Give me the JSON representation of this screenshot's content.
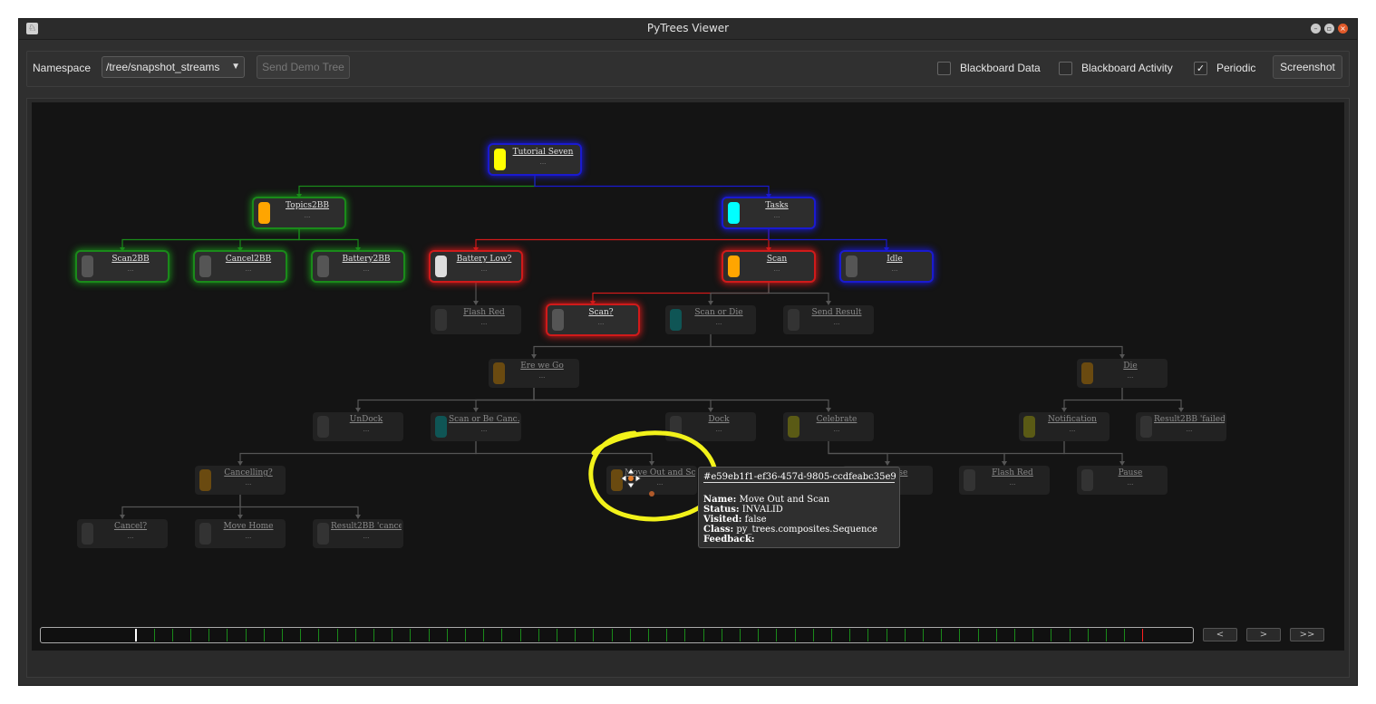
{
  "window": {
    "title": "PyTrees Viewer"
  },
  "toolbar": {
    "namespace_label": "Namespace",
    "namespace_value": "/tree/snapshot_streams",
    "send_demo_label": "Send Demo Tree",
    "blackboard_data_label": "Blackboard Data",
    "blackboard_activity_label": "Blackboard Activity",
    "periodic_label": "Periodic",
    "screenshot_label": "Screenshot",
    "blackboard_data_checked": false,
    "blackboard_activity_checked": false,
    "periodic_checked": true
  },
  "colors": {
    "success": "#1a8a1a",
    "running": "#1a1ad0",
    "failure": "#d01a1a",
    "invalid": "#555555"
  },
  "nodes": [
    {
      "id": "tutorial-seven",
      "name": "Tutorial Seven",
      "detail": "...",
      "swatch": "#ffff00",
      "glow": "running"
    },
    {
      "id": "topics2bb",
      "name": "Topics2BB",
      "detail": "...",
      "swatch": "#ffa500",
      "glow": "success"
    },
    {
      "id": "tasks",
      "name": "Tasks",
      "detail": "...",
      "swatch": "#00ffff",
      "glow": "running"
    },
    {
      "id": "scan2bb",
      "name": "Scan2BB",
      "detail": "...",
      "swatch": "#555555",
      "glow": "success"
    },
    {
      "id": "cancel2bb",
      "name": "Cancel2BB",
      "detail": "...",
      "swatch": "#555555",
      "glow": "success"
    },
    {
      "id": "battery2bb",
      "name": "Battery2BB",
      "detail": "...",
      "swatch": "#555555",
      "glow": "success"
    },
    {
      "id": "battery-low",
      "name": "Battery Low?",
      "detail": "...",
      "swatch": "#dddddd",
      "glow": "failure"
    },
    {
      "id": "scan",
      "name": "Scan",
      "detail": "...",
      "swatch": "#ffa500",
      "glow": "failure"
    },
    {
      "id": "idle",
      "name": "Idle",
      "detail": "...",
      "swatch": "#555555",
      "glow": "running"
    },
    {
      "id": "flash-red-1",
      "name": "Flash Red",
      "detail": "...",
      "swatch": "#333333",
      "glow": "none"
    },
    {
      "id": "scan-q",
      "name": "Scan?",
      "detail": "...",
      "swatch": "#555555",
      "glow": "failure"
    },
    {
      "id": "scan-or-die",
      "name": "Scan or Die",
      "detail": "...",
      "swatch": "#0f5555",
      "glow": "none"
    },
    {
      "id": "send-result",
      "name": "Send Result",
      "detail": "...",
      "swatch": "#333333",
      "glow": "none"
    },
    {
      "id": "ere-we-go",
      "name": "Ere we Go",
      "detail": "...",
      "swatch": "#6a4a10",
      "glow": "none"
    },
    {
      "id": "die",
      "name": "Die",
      "detail": "...",
      "swatch": "#6a4a10",
      "glow": "none"
    },
    {
      "id": "undock",
      "name": "UnDock",
      "detail": "...",
      "swatch": "#333333",
      "glow": "none"
    },
    {
      "id": "scan-or-be-cancelled",
      "name": "Scan or Be Canc...",
      "detail": "...",
      "swatch": "#0f5555",
      "glow": "none"
    },
    {
      "id": "dock",
      "name": "Dock",
      "detail": "...",
      "swatch": "#333333",
      "glow": "none"
    },
    {
      "id": "celebrate",
      "name": "Celebrate",
      "detail": "...",
      "swatch": "#5a5a15",
      "glow": "none"
    },
    {
      "id": "notification",
      "name": "Notification",
      "detail": "...",
      "swatch": "#5a5a15",
      "glow": "none"
    },
    {
      "id": "result2bb-failed",
      "name": "Result2BB 'failed'",
      "detail": "...",
      "swatch": "#333333",
      "glow": "none"
    },
    {
      "id": "cancelling",
      "name": "Cancelling?",
      "detail": "...",
      "swatch": "#6a4a10",
      "glow": "none"
    },
    {
      "id": "move-out-and-scan",
      "name": "Move Out and Sc...",
      "detail": "...",
      "swatch": "#6a4a10",
      "glow": "none"
    },
    {
      "id": "pause-hidden",
      "name": "Pause",
      "detail": "...",
      "swatch": "#333333",
      "glow": "none"
    },
    {
      "id": "flash-red-2",
      "name": "Flash Red",
      "detail": "...",
      "swatch": "#333333",
      "glow": "none"
    },
    {
      "id": "pause",
      "name": "Pause",
      "detail": "...",
      "swatch": "#333333",
      "glow": "none"
    },
    {
      "id": "cancel-q",
      "name": "Cancel?",
      "detail": "...",
      "swatch": "#333333",
      "glow": "none"
    },
    {
      "id": "move-home",
      "name": "Move Home",
      "detail": "...",
      "swatch": "#333333",
      "glow": "none"
    },
    {
      "id": "result2bb-cancelled",
      "name": "Result2BB 'cance...",
      "detail": "...",
      "swatch": "#333333",
      "glow": "none"
    }
  ],
  "tooltip": {
    "id_text": "#e59eb1f1-ef36-457d-9805-ccdfeabc35e9",
    "name_label": "Name:",
    "name_value": "Move Out and Scan",
    "status_label": "Status:",
    "status_value": "INVALID",
    "visited_label": "Visited:",
    "visited_value": "false",
    "class_label": "Class:",
    "class_value": "py_trees.composites.Sequence",
    "feedback_label": "Feedback:",
    "feedback_value": ""
  },
  "navigation": {
    "prev": "<",
    "next": ">",
    "last": ">>"
  },
  "timeline": {
    "tick_count": 58,
    "current_index": 3,
    "latest_index": 57
  }
}
